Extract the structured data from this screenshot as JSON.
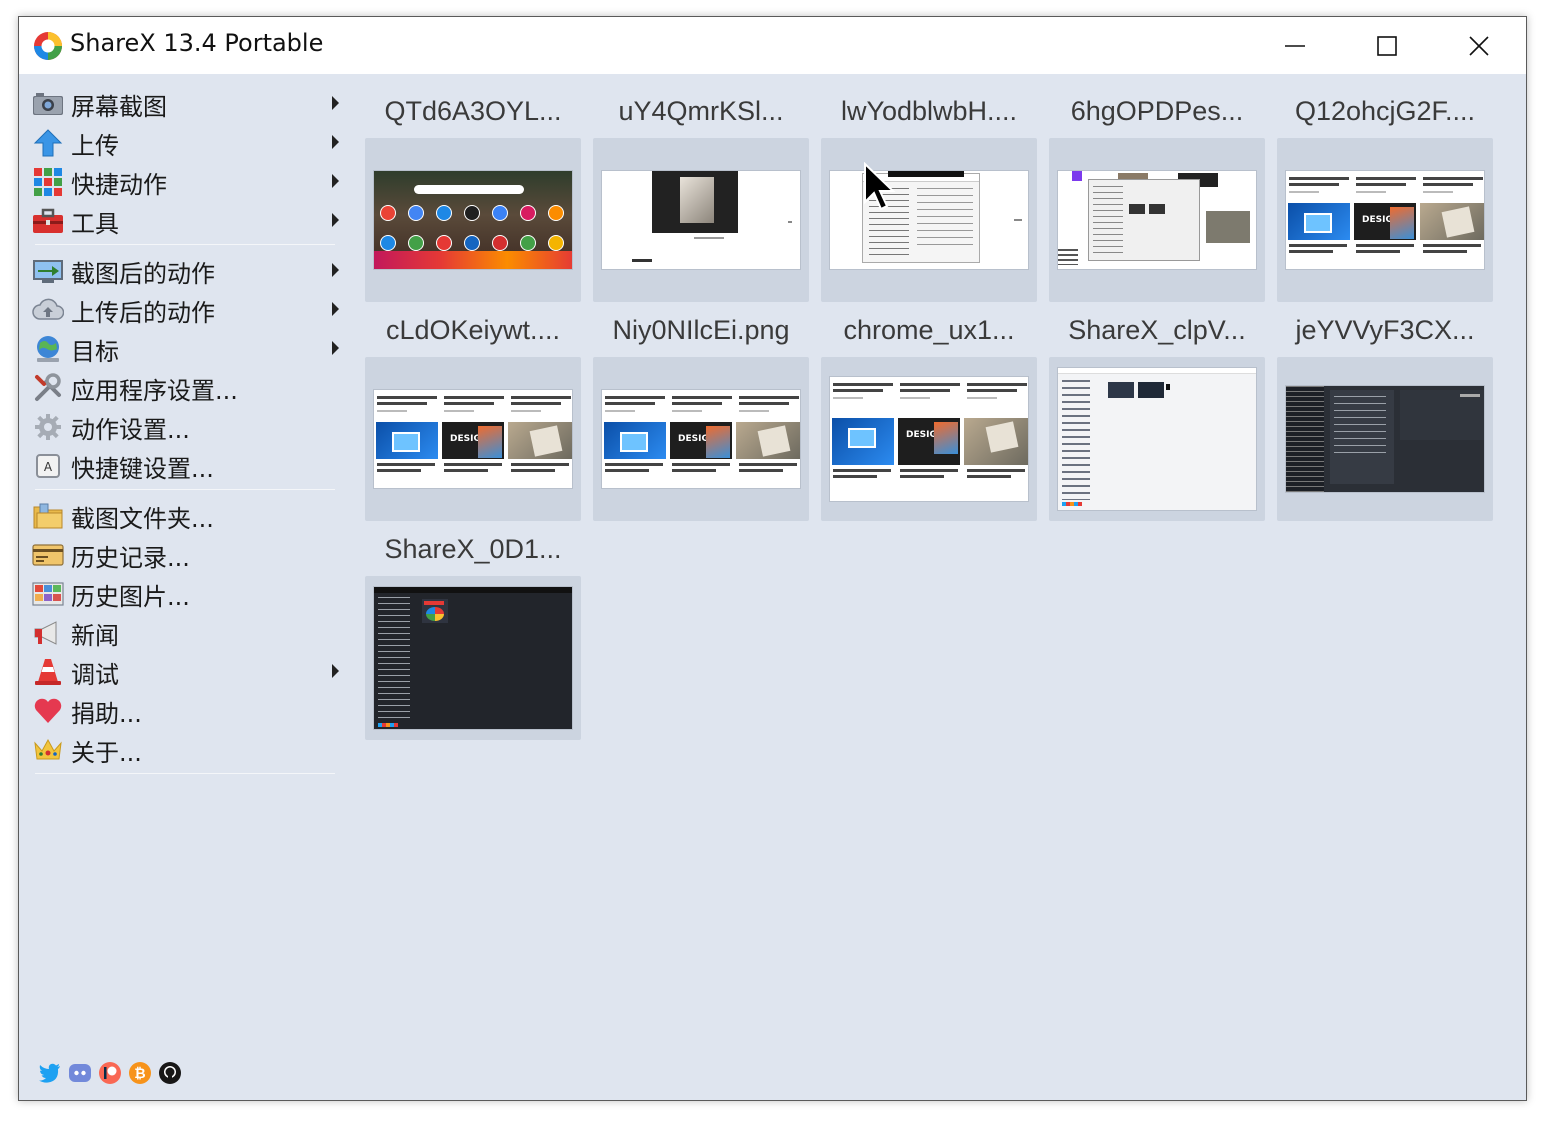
{
  "window": {
    "title": "ShareX 13.4 Portable",
    "controls": {
      "minimize": "minimize",
      "maximize": "maximize",
      "close": "close"
    }
  },
  "sidebar": {
    "groups": [
      [
        {
          "label": "屏幕截图",
          "icon": "camera-icon",
          "submenu": true
        },
        {
          "label": "上传",
          "icon": "upload-arrow-icon",
          "submenu": true
        },
        {
          "label": "快捷动作",
          "icon": "grid-icon",
          "submenu": true
        },
        {
          "label": "工具",
          "icon": "toolbox-icon",
          "submenu": true
        }
      ],
      [
        {
          "label": "截图后的动作",
          "icon": "monitor-action-icon",
          "submenu": true
        },
        {
          "label": "上传后的动作",
          "icon": "cloud-upload-icon",
          "submenu": true
        },
        {
          "label": "目标",
          "icon": "globe-target-icon",
          "submenu": true
        },
        {
          "label": "应用程序设置...",
          "icon": "wrench-icon",
          "submenu": false
        },
        {
          "label": "动作设置...",
          "icon": "gear-icon",
          "submenu": false
        },
        {
          "label": "快捷键设置...",
          "icon": "keyboard-icon",
          "submenu": false
        }
      ],
      [
        {
          "label": "截图文件夹...",
          "icon": "folder-icon",
          "submenu": false
        },
        {
          "label": "历史记录...",
          "icon": "history-card-icon",
          "submenu": false
        },
        {
          "label": "历史图片...",
          "icon": "image-history-icon",
          "submenu": false
        },
        {
          "label": "新闻",
          "icon": "megaphone-icon",
          "submenu": false
        },
        {
          "label": "调试",
          "icon": "traffic-cone-icon",
          "submenu": true
        },
        {
          "label": "捐助...",
          "icon": "heart-icon",
          "submenu": false
        },
        {
          "label": "关于...",
          "icon": "crown-icon",
          "submenu": false
        }
      ]
    ],
    "social": [
      "twitter-icon",
      "discord-icon",
      "patreon-icon",
      "bitcoin-icon",
      "github-icon"
    ]
  },
  "thumbnails": [
    {
      "title": "QTd6A3OYL...",
      "kind": "photo-apps"
    },
    {
      "title": "uY4QmrKSl...",
      "kind": "ipad-white"
    },
    {
      "title": "lwYodblwbH....",
      "kind": "dialog"
    },
    {
      "title": "6hgOPDPes...",
      "kind": "overlap"
    },
    {
      "title": "Q12ohcjG2F....",
      "kind": "articles"
    },
    {
      "title": "cLdOKeiywt....",
      "kind": "articles"
    },
    {
      "title": "Niy0NIlcEi.png",
      "kind": "articles"
    },
    {
      "title": "chrome_ux1...",
      "kind": "articles-tall"
    },
    {
      "title": "ShareX_clpV...",
      "kind": "sharex-light"
    },
    {
      "title": "jeYVVyF3CX...",
      "kind": "dark-settings"
    },
    {
      "title": "ShareX_0D1...",
      "kind": "sharex-dark"
    }
  ],
  "colors": {
    "window_bg": "#dfe5ef",
    "tile_bg": "#ccd4e0",
    "title_text": "#3a3a3a"
  }
}
